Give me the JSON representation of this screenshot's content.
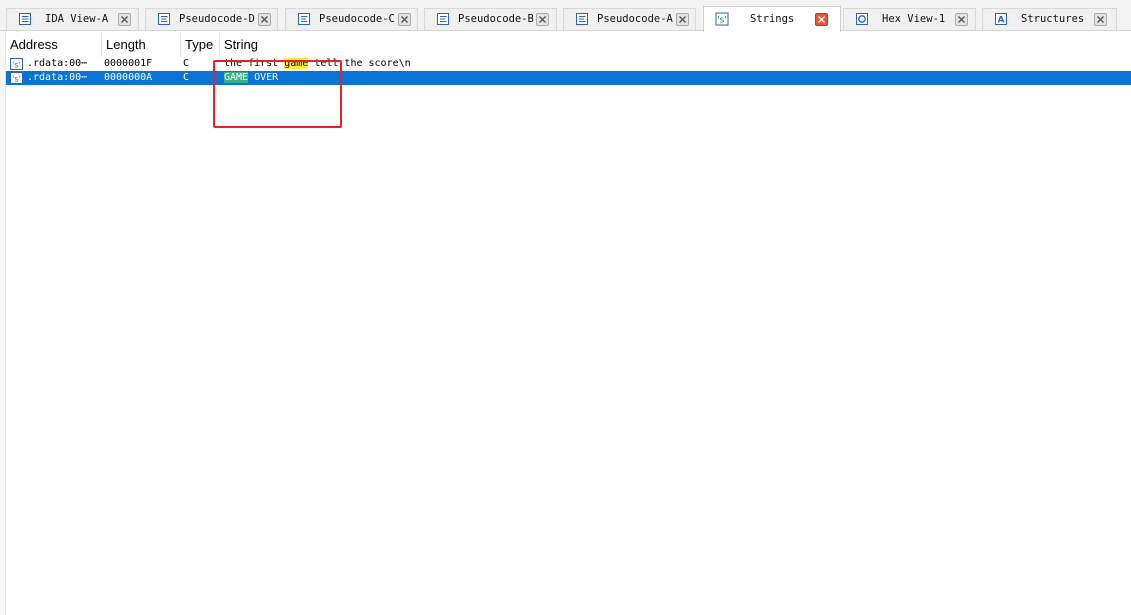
{
  "tabs": [
    {
      "label": "IDA View-A",
      "icon": "listing-icon",
      "active": false
    },
    {
      "label": "Pseudocode-D",
      "icon": "pseudocode-icon",
      "active": false
    },
    {
      "label": "Pseudocode-C",
      "icon": "pseudocode-icon",
      "active": false
    },
    {
      "label": "Pseudocode-B",
      "icon": "pseudocode-icon",
      "active": false
    },
    {
      "label": "Pseudocode-A",
      "icon": "pseudocode-icon",
      "active": false
    },
    {
      "label": "Strings",
      "icon": "strings-icon",
      "active": true
    },
    {
      "label": "Hex View-1",
      "icon": "hex-icon",
      "active": false
    },
    {
      "label": "Structures",
      "icon": "structures-icon",
      "active": false
    }
  ],
  "table": {
    "columns": [
      "Address",
      "Length",
      "Type",
      "String"
    ],
    "rows": [
      {
        "address": ".rdata:00⋯",
        "length": "0000001F",
        "type": "C",
        "string_before": "the first ",
        "string_match": "game",
        "string_after": " tell the score\\n",
        "selected": false
      },
      {
        "address": ".rdata:00⋯",
        "length": "0000000A",
        "type": "C",
        "string_before": "",
        "string_match": "GAME",
        "string_after": " OVER",
        "selected": true
      }
    ]
  },
  "colors": {
    "selection": "#0a74d6",
    "search_highlight": "#f7ef3a",
    "selected_match_highlight": "#35b08a",
    "active_tab_close": "#e8563a",
    "annotation": "#e8202a"
  }
}
